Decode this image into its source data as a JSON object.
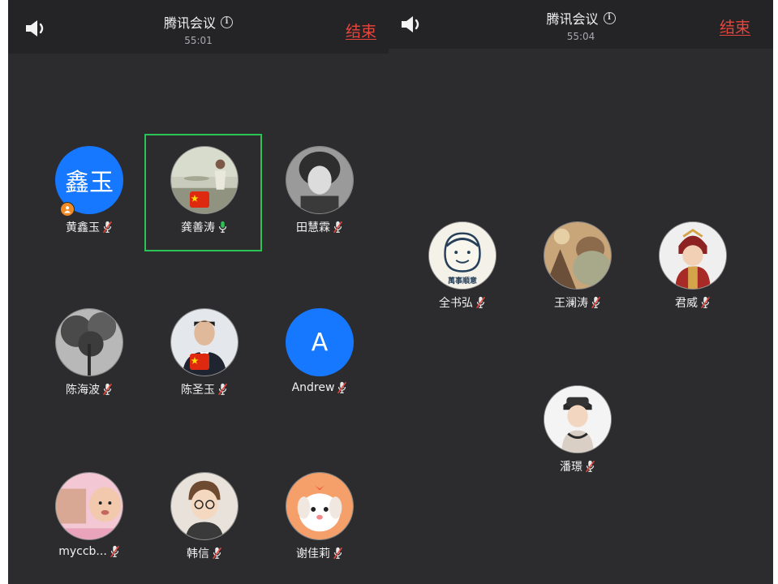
{
  "screens": [
    {
      "title": "腾讯会议",
      "timer": "55:01",
      "end_label": "结束",
      "participants": [
        {
          "name": "黄鑫玉",
          "initials": "鑫玉",
          "mic": "muted",
          "host": true
        },
        {
          "name": "龚善涛",
          "mic": "active",
          "speaking": true
        },
        {
          "name": "田慧霖",
          "mic": "muted"
        },
        {
          "name": "陈海波",
          "mic": "muted"
        },
        {
          "name": "陈圣玉",
          "mic": "muted"
        },
        {
          "name": "Andrew",
          "initials": "A",
          "mic": "muted"
        },
        {
          "name": "myccb...",
          "mic": "muted"
        },
        {
          "name": "韩信",
          "mic": "muted"
        },
        {
          "name": "谢佳莉",
          "mic": "muted"
        }
      ]
    },
    {
      "title": "腾讯会议",
      "timer": "55:04",
      "end_label": "结束",
      "participants": [
        {
          "name": "全书弘",
          "avatar_text": "萬事順意",
          "mic": "muted"
        },
        {
          "name": "王澜涛",
          "mic": "muted"
        },
        {
          "name": "君威",
          "mic": "muted"
        },
        {
          "name": "潘璟",
          "mic": "muted"
        }
      ]
    }
  ],
  "colors": {
    "end": "#e8453c",
    "speaking": "#2bc356",
    "avatar_blue": "#1677ff",
    "host_badge": "#f08a24"
  },
  "icons": [
    "speaker-icon",
    "info-icon",
    "mic-muted-icon",
    "mic-icon",
    "host-icon",
    "flag-badge-icon"
  ]
}
